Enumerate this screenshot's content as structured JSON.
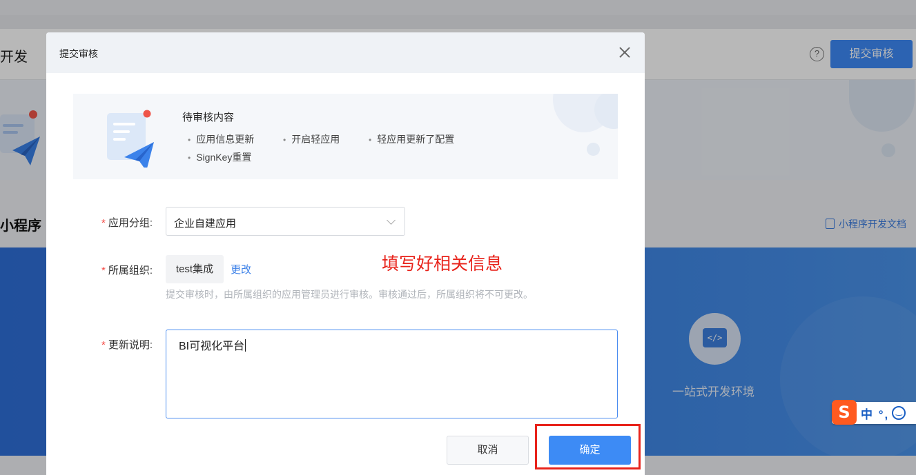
{
  "background": {
    "page_title": "开发",
    "header_submit_label": "提交审核",
    "help_icon": "question-circle-icon",
    "section_title": "小程序",
    "doc_link_label": "小程序开发文档",
    "tool_label": "一站式开发环境",
    "tool_icon_glyph": "</>"
  },
  "ime": {
    "logo": "S",
    "text": "中 °,"
  },
  "modal": {
    "title": "提交审核",
    "pending": {
      "title": "待审核内容",
      "items": [
        "应用信息更新",
        "开启轻应用",
        "轻应用更新了配置",
        "SignKey重置"
      ]
    },
    "form": {
      "group_label": "应用分组:",
      "group_value": "企业自建应用",
      "org_label": "所属组织:",
      "org_value": "test集成",
      "org_change": "更改",
      "org_hint": "提交审核时，由所属组织的应用管理员进行审核。审核通过后，所属组织将不可更改。",
      "desc_label": "更新说明:",
      "desc_value": "BI可视化平台",
      "required_mark": "*"
    },
    "annotation": "填写好相关信息",
    "buttons": {
      "cancel": "取消",
      "ok": "确定"
    }
  },
  "colors": {
    "primary": "#3d8bf5",
    "annotation": "#e8231b",
    "required": "#f54a45"
  }
}
